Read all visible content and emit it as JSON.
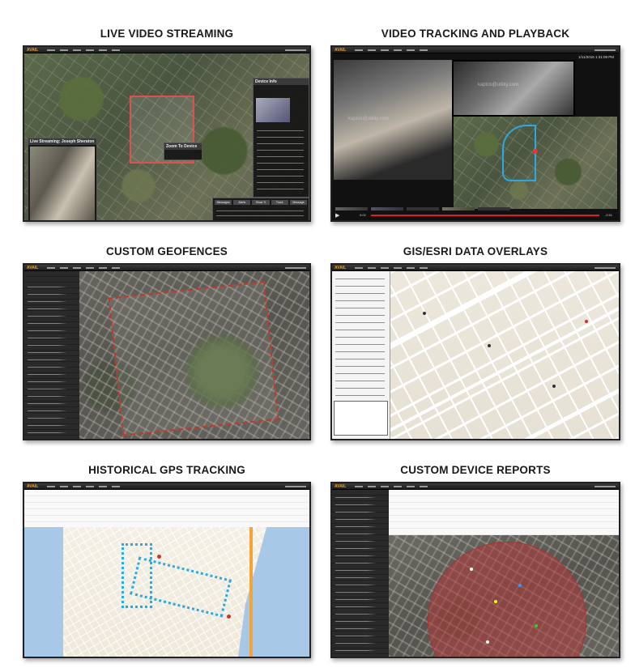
{
  "panels": [
    {
      "title": "LIVE VIDEO STREAMING"
    },
    {
      "title": "VIDEO TRACKING AND PLAYBACK"
    },
    {
      "title": "CUSTOM GEOFENCES"
    },
    {
      "title": "GIS/ESRI DATA OVERLAYS"
    },
    {
      "title": "HISTORICAL GPS TRACKING"
    },
    {
      "title": "CUSTOM DEVICE REPORTS"
    }
  ],
  "app": {
    "logo": "AVAIL"
  },
  "live_video": {
    "stream_title": "Live Streaming: Joseph Sheraton",
    "info_title": "Device Info",
    "buttons": [
      "Messages",
      "Alerts",
      "Show Tr",
      "Track",
      "Message"
    ]
  },
  "playback": {
    "timestamp": "1/11/2016 1:31:09 PM",
    "watermark": "kaptos@utility.com",
    "time_left": "0:02",
    "time_right": "-2:51"
  },
  "colors": {
    "fence": "#c0392b",
    "route": "#2da8e0",
    "frame": "#222222",
    "accent": "#f0a020",
    "zone": "#b23a3a"
  }
}
